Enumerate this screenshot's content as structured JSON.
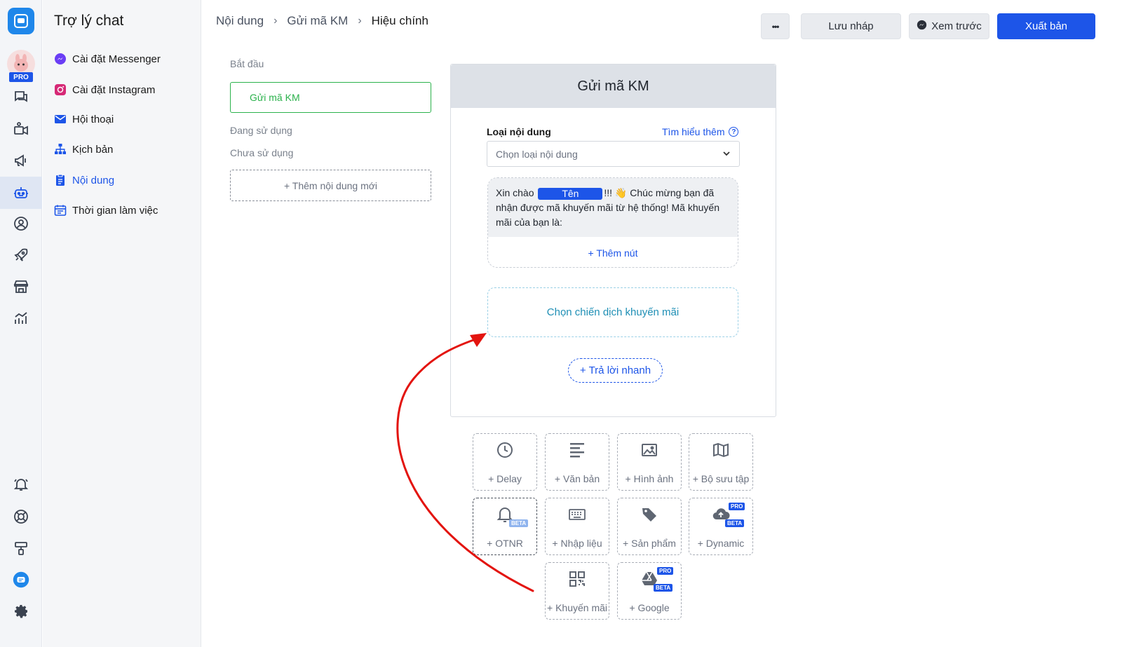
{
  "sidebar_rail": {
    "pro_badge": "PRO",
    "items": [
      "chat-icon",
      "video-icon",
      "megaphone-icon",
      "bot-icon",
      "contact-icon",
      "rocket-icon",
      "store-icon",
      "analytics-icon",
      "bell-icon",
      "help-icon",
      "tools-icon",
      "messenger-bubble-icon",
      "settings-icon"
    ]
  },
  "sidemenu": {
    "title": "Trợ lý chat",
    "items": [
      {
        "label": "Cài đặt Messenger",
        "icon": "messenger-icon"
      },
      {
        "label": "Cài đặt Instagram",
        "icon": "instagram-icon"
      },
      {
        "label": "Hội thoại",
        "icon": "mail-icon"
      },
      {
        "label": "Kịch bản",
        "icon": "flow-icon"
      },
      {
        "label": "Nội dung",
        "icon": "content-icon"
      },
      {
        "label": "Thời gian làm việc",
        "icon": "calendar-icon"
      }
    ]
  },
  "header": {
    "breadcrumb": [
      "Nội dung",
      "Gửi mã KM",
      "Hiệu chính"
    ],
    "more_label": "•••",
    "draft_label": "Lưu nháp",
    "preview_label": "Xem trước",
    "publish_label": "Xuất bản"
  },
  "content_list": {
    "start_label": "Bắt đầu",
    "active_item": "Gửi mã KM",
    "in_use_label": "Đang sử dụng",
    "unused_label": "Chưa sử dụng",
    "add_new": "+ Thêm nội dung mới"
  },
  "editor": {
    "title": "Gửi mã KM",
    "type_label": "Loại nội dung",
    "learn_more": "Tìm hiểu thêm",
    "select_placeholder": "Chọn loại nội dung",
    "message": {
      "prefix": "Xin chào",
      "name_chip": "Tên",
      "suffix": "!!! 👋 Chúc mừng bạn đã nhận được mã khuyến mãi từ hệ thống! Mã khuyến mãi của bạn là:"
    },
    "add_button": "+ Thêm nút",
    "promo_select": "Chọn chiến dịch khuyến mãi",
    "quick_reply": "+ Trả lời nhanh"
  },
  "blocks": [
    {
      "label": "+ Delay",
      "icon": "clock-icon"
    },
    {
      "label": "+ Văn bản",
      "icon": "text-icon"
    },
    {
      "label": "+ Hình ảnh",
      "icon": "image-icon"
    },
    {
      "label": "+ Bộ sưu tập",
      "icon": "map-icon"
    },
    {
      "label": "+ OTNR",
      "icon": "bell-icon",
      "badges": [
        "BETA"
      ]
    },
    {
      "label": "+ Nhập liệu",
      "icon": "keyboard-icon"
    },
    {
      "label": "+ Sản phẩm",
      "icon": "tag-icon"
    },
    {
      "label": "+ Dynamic",
      "icon": "cloud-upload-icon",
      "badges": [
        "PRO",
        "BETA"
      ]
    },
    {
      "label": "+ Khuyến mãi",
      "icon": "qr-code-icon"
    },
    {
      "label": "+ Google",
      "icon": "google-drive-icon",
      "badges": [
        "PRO",
        "BETA"
      ]
    }
  ],
  "colors": {
    "primary": "#1d55e8",
    "active_border": "#2bb24c",
    "annotation_arrow": "#e3140f"
  }
}
